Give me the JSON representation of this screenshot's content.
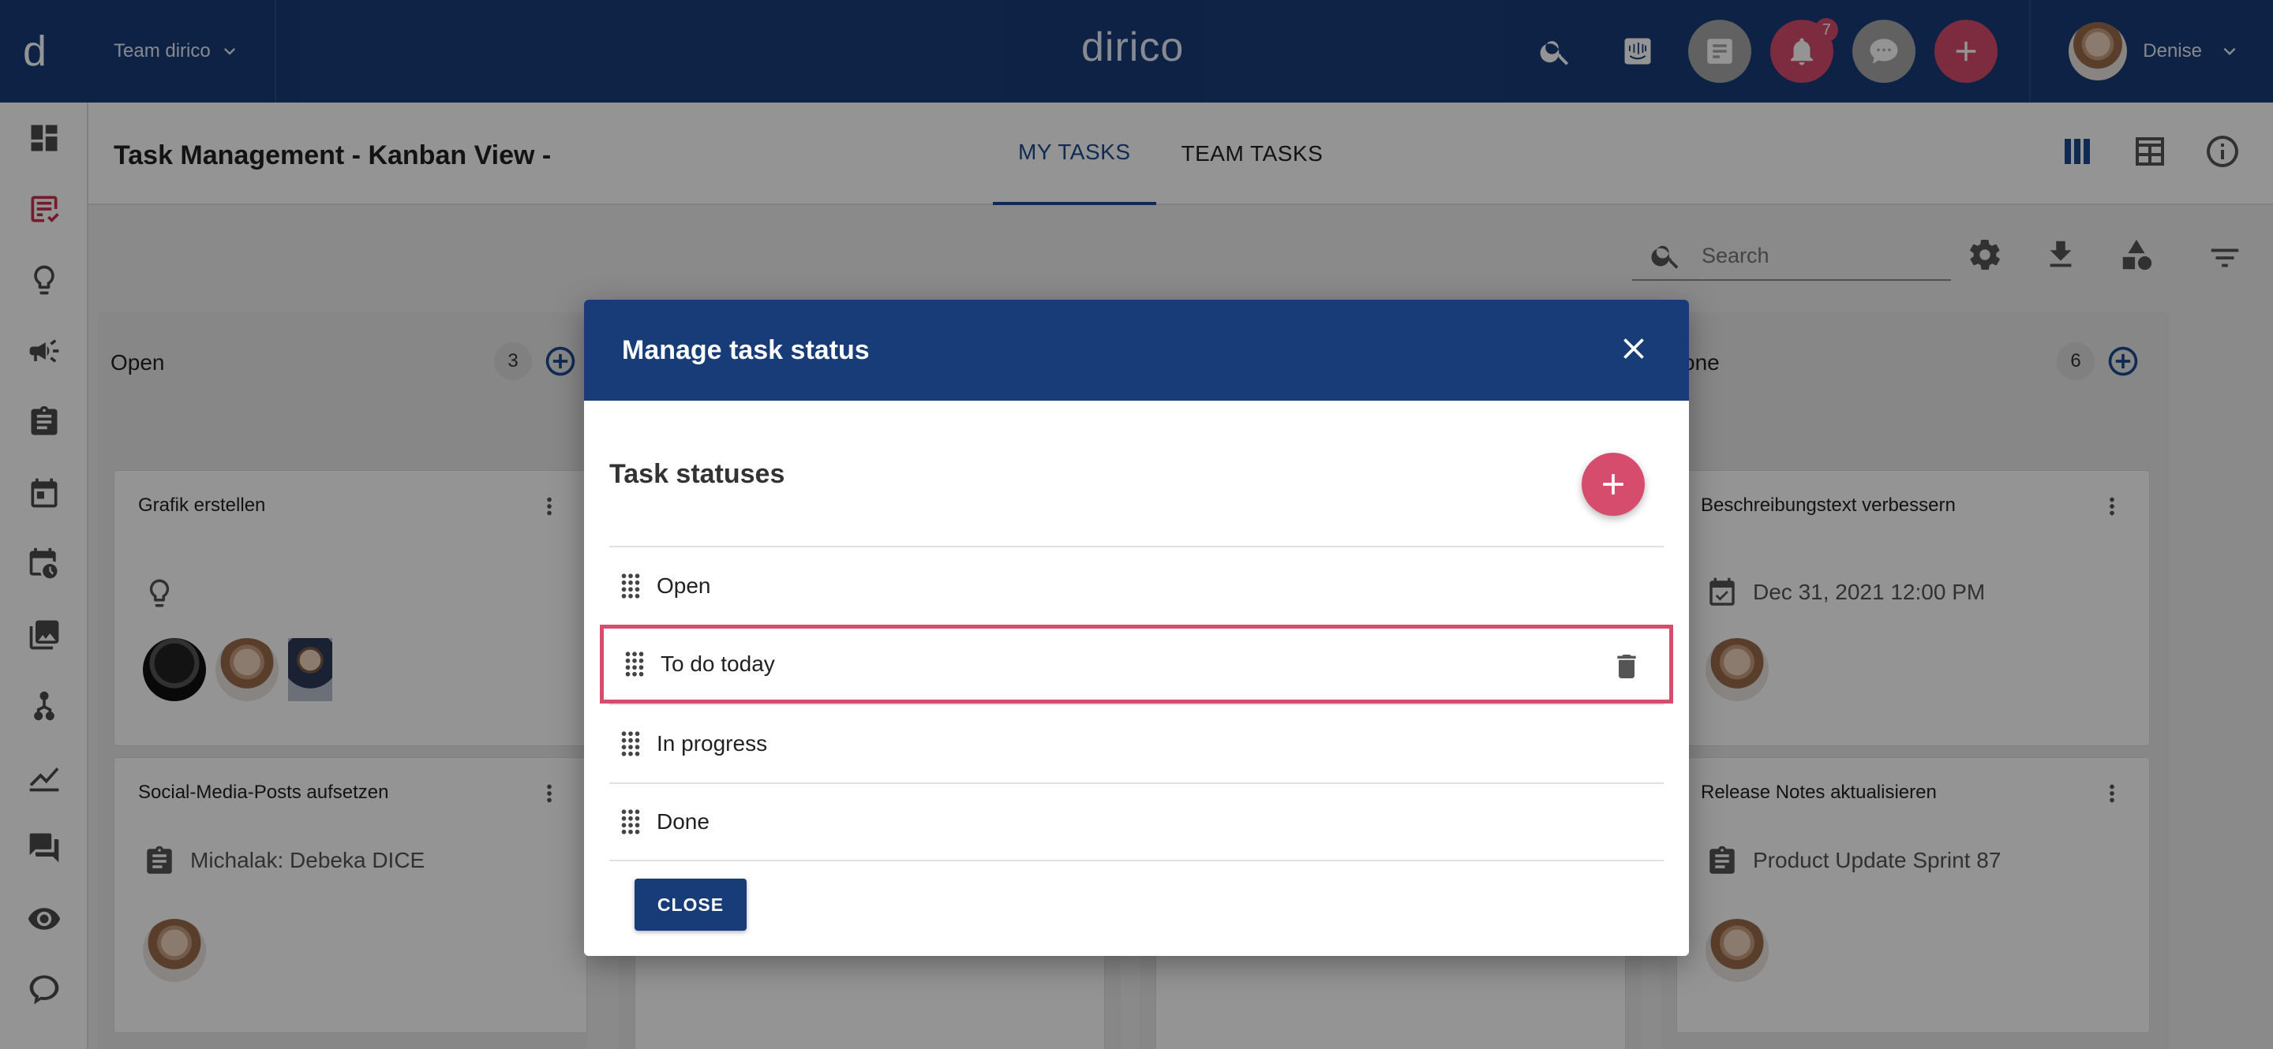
{
  "topbar": {
    "logo_letter": "d",
    "team_label": "Team dirico",
    "app_name": "dirico",
    "notifications_count": "7",
    "user_name": "Denise"
  },
  "header": {
    "title": "Task Management - Kanban View -",
    "tabs": [
      {
        "label": "MY TASKS",
        "active": true
      },
      {
        "label": "TEAM TASKS",
        "active": false
      }
    ]
  },
  "toolbar": {
    "search_placeholder": "Search"
  },
  "columns": [
    {
      "name": "Open",
      "count": "3",
      "cards": [
        {
          "title": "Grafik erstellen",
          "detail": ""
        },
        {
          "title": "Social-Media-Posts aufsetzen",
          "detail": "Michalak: Debeka DICE"
        }
      ]
    },
    {
      "name": "one",
      "count": "6",
      "cards": [
        {
          "title": "Beschreibungstext verbessern",
          "detail": "Dec 31, 2021 12:00 PM"
        },
        {
          "title": "Release Notes aktualisieren",
          "detail": "Product Update Sprint 87"
        }
      ]
    }
  ],
  "dialog": {
    "title": "Manage task status",
    "section_title": "Task statuses",
    "statuses": [
      "Open",
      "To do today",
      "In progress",
      "Done"
    ],
    "close_label": "CLOSE"
  },
  "colors": {
    "primary": "#183c78",
    "accent": "#d64c6c",
    "active_nav": "#c5334f"
  }
}
